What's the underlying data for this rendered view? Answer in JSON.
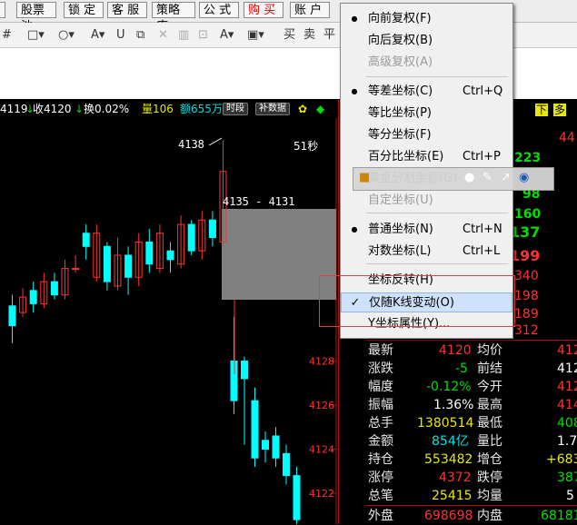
{
  "topbar": {
    "buttons": [
      "股票池",
      "锁 定",
      "客 服",
      "策略库",
      "公 式",
      "购 买",
      "账 户"
    ]
  },
  "drawbar": {
    "tools": [
      "#",
      "□",
      "○",
      "A",
      "|∪",
      "⧉",
      "✕",
      "🗑",
      "A",
      "▢",
      "买",
      "卖",
      "平"
    ]
  },
  "quote": {
    "open": "4119",
    "close_label": "收4120",
    "turnover": "换0.02%",
    "volume": "量106",
    "amount": "额655万",
    "btn_period": "时段",
    "btn_fill": "补数据"
  },
  "chart": {
    "high_label": "4138",
    "timer": "51秒",
    "range_label": "4135 - 4131",
    "y_ticks": [
      "4128",
      "4126",
      "4124",
      "4122"
    ],
    "colors": {
      "up": "#ff3232",
      "down": "#00ffff",
      "axis": "#b01010"
    }
  },
  "rpanel": {
    "top_right_btns": [
      "下",
      "多"
    ],
    "top_values": [
      "44",
      "223",
      "98",
      "160",
      "137",
      "199",
      "340",
      "198",
      "189",
      "312"
    ],
    "side_values": [
      "4",
      "4",
      "4",
      "4",
      "4",
      "4",
      "4",
      "4",
      "4",
      "4"
    ],
    "rows": [
      {
        "l1": "最新",
        "v1": "4120",
        "l2": "均价",
        "v2": "412"
      },
      {
        "l1": "涨跌",
        "v1": "-5",
        "l2": "前结",
        "v2": "412"
      },
      {
        "l1": "幅度",
        "v1": "-0.12%",
        "l2": "今开",
        "v2": "412"
      },
      {
        "l1": "振幅",
        "v1": "1.36%",
        "l2": "最高",
        "v2": "414"
      },
      {
        "l1": "总手",
        "v1": "1380514",
        "l2": "最低",
        "v2": "408"
      },
      {
        "l1": "金额",
        "v1": "854亿",
        "l2": "量比",
        "v2": "1.7"
      },
      {
        "l1": "持仓",
        "v1": "553482",
        "l2": "增仓",
        "v2": "+683"
      },
      {
        "l1": "涨停",
        "v1": "4372",
        "l2": "跌停",
        "v2": "387"
      },
      {
        "l1": "总笔",
        "v1": "25415",
        "l2": "均量",
        "v2": "5"
      },
      {
        "l1": "外盘",
        "v1": "698698",
        "l2": "内盘",
        "v2": "68181"
      }
    ]
  },
  "menu": {
    "items": [
      {
        "label": "向前复权(F)",
        "shortcut": "",
        "checked": "dot",
        "disabled": false
      },
      {
        "label": "向后复权(B)",
        "shortcut": "",
        "checked": "",
        "disabled": false
      },
      {
        "label": "高级复权(A)",
        "shortcut": "",
        "checked": "",
        "disabled": true
      },
      {
        "label": "等差坐标(C)",
        "shortcut": "Ctrl+Q",
        "checked": "dot",
        "disabled": false
      },
      {
        "label": "等比坐标(P)",
        "shortcut": "",
        "checked": "",
        "disabled": false
      },
      {
        "label": "等分坐标(F)",
        "shortcut": "",
        "checked": "",
        "disabled": false
      },
      {
        "label": "百分比坐标(E)",
        "shortcut": "Ctrl+P",
        "checked": "",
        "disabled": false
      },
      {
        "label": "黄金分割坐标(G)",
        "shortcut": "",
        "checked": "",
        "disabled": false
      },
      {
        "label": "自定坐标(U)",
        "shortcut": "",
        "checked": "",
        "disabled": true
      },
      {
        "label": "普通坐标(N)",
        "shortcut": "Ctrl+N",
        "checked": "dot",
        "disabled": false
      },
      {
        "label": "对数坐标(L)",
        "shortcut": "Ctrl+L",
        "checked": "",
        "disabled": false
      },
      {
        "label": "坐标反转(H)",
        "shortcut": "",
        "checked": "",
        "disabled": false
      },
      {
        "label": "仅随K线变动(O)",
        "shortcut": "",
        "checked": "check",
        "disabled": false
      },
      {
        "label": "Y坐标属性(Y)...",
        "shortcut": "",
        "checked": "",
        "disabled": false
      }
    ]
  },
  "candles": [
    {
      "o": 4130.5,
      "c": 4129.6,
      "h": 4131.0,
      "l": 4128.8
    },
    {
      "o": 4130.2,
      "c": 4130.9,
      "h": 4131.3,
      "l": 4130.0
    },
    {
      "o": 4131.2,
      "c": 4130.6,
      "h": 4131.6,
      "l": 4130.2
    },
    {
      "o": 4130.6,
      "c": 4131.6,
      "h": 4132.0,
      "l": 4130.4
    },
    {
      "o": 4131.6,
      "c": 4131.0,
      "h": 4132.0,
      "l": 4130.8
    },
    {
      "o": 4131.0,
      "c": 4132.2,
      "h": 4132.6,
      "l": 4130.8
    },
    {
      "o": 4132.2,
      "c": 4132.2,
      "h": 4132.8,
      "l": 4132.0
    },
    {
      "o": 4133.8,
      "c": 4133.2,
      "h": 4134.2,
      "l": 4132.6
    },
    {
      "o": 4131.8,
      "c": 4133.8,
      "h": 4134.2,
      "l": 4131.6
    },
    {
      "o": 4133.2,
      "c": 4131.6,
      "h": 4133.4,
      "l": 4131.2
    },
    {
      "o": 4131.4,
      "c": 4132.8,
      "h": 4133.6,
      "l": 4131.2
    },
    {
      "o": 4132.8,
      "c": 4131.8,
      "h": 4133.2,
      "l": 4131.0
    },
    {
      "o": 4131.8,
      "c": 4133.4,
      "h": 4133.8,
      "l": 4131.4
    },
    {
      "o": 4133.4,
      "c": 4132.4,
      "h": 4134.0,
      "l": 4132.0
    },
    {
      "o": 4132.2,
      "c": 4133.8,
      "h": 4134.2,
      "l": 4132.0
    },
    {
      "o": 4133.0,
      "c": 4132.6,
      "h": 4133.4,
      "l": 4132.0
    },
    {
      "o": 4132.4,
      "c": 4134.2,
      "h": 4134.6,
      "l": 4132.2
    },
    {
      "o": 4134.2,
      "c": 4133.0,
      "h": 4134.4,
      "l": 4132.8
    },
    {
      "o": 4133.0,
      "c": 4134.4,
      "h": 4134.8,
      "l": 4132.6
    },
    {
      "o": 4134.4,
      "c": 4133.6,
      "h": 4134.8,
      "l": 4133.2
    },
    {
      "o": 4133.4,
      "c": 4136.6,
      "h": 4138.0,
      "l": 4133.2
    }
  ],
  "candles_right": [
    {
      "o": 4128.0,
      "c": 4126.2,
      "h": 4130.0,
      "l": 4125.6
    },
    {
      "o": 4128.0,
      "c": 4127.2,
      "h": 4128.2,
      "l": 4124.2
    },
    {
      "o": 4126.2,
      "c": 4123.6,
      "h": 4126.8,
      "l": 4123.2
    },
    {
      "o": 4124.4,
      "c": 4124.0,
      "h": 4124.8,
      "l": 4123.4
    },
    {
      "o": 4124.6,
      "c": 4123.6,
      "h": 4125.0,
      "l": 4123.2
    },
    {
      "o": 4123.8,
      "c": 4122.8,
      "h": 4124.2,
      "l": 4122.4
    },
    {
      "o": 4122.8,
      "c": 4120.8,
      "h": 4123.2,
      "l": 4120.6
    }
  ]
}
